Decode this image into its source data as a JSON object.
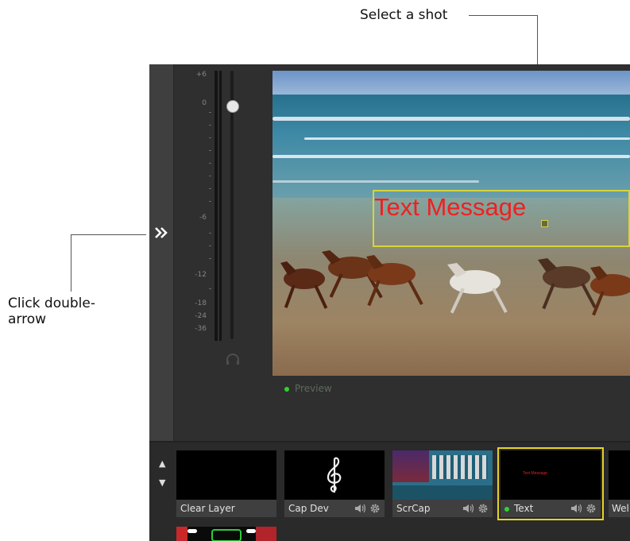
{
  "callouts": {
    "select_shot": "Select a shot",
    "click_arrow_line1": "Click double-",
    "click_arrow_line2": "arrow"
  },
  "icons": {
    "expand": "double-chevron-right-icon",
    "speaker": "speaker-icon",
    "gear": "gear-icon",
    "headphones": "headphones-icon",
    "up": "triangle-up-icon",
    "down": "triangle-down-icon",
    "treble_clef": "treble-clef-icon"
  },
  "meter": {
    "labels": [
      "+6",
      "0",
      "-6",
      "-12",
      "-18",
      "-24",
      "-36"
    ]
  },
  "preview": {
    "label": "Preview",
    "overlay_text": "Text Message"
  },
  "shots": [
    {
      "label": "Clear Layer"
    },
    {
      "label": "Cap Dev"
    },
    {
      "label": "ScrCap"
    },
    {
      "label": "Text",
      "mini_text": "Text Message"
    },
    {
      "label": "Wel"
    }
  ],
  "colors": {
    "selection": "#e3d325",
    "live_green": "#2bd62b",
    "overlay_red": "#ef2020"
  }
}
